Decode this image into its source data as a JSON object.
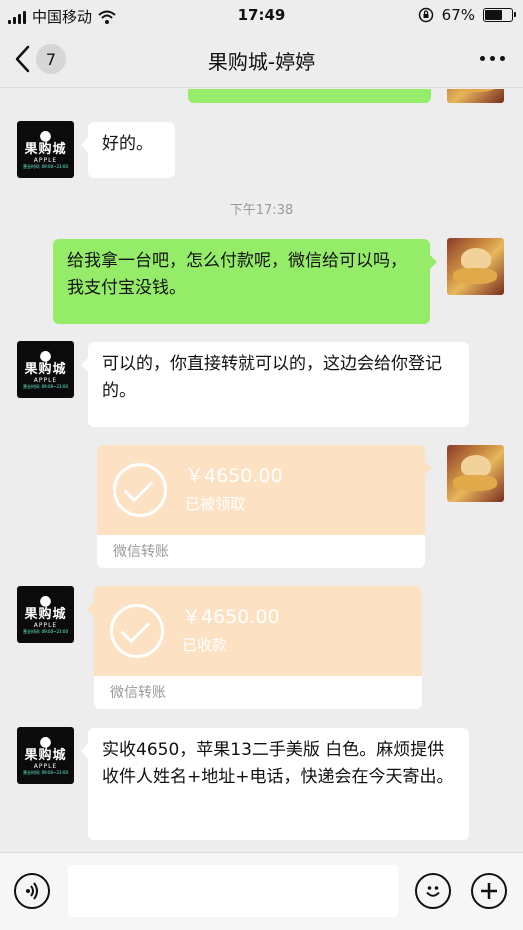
{
  "status_bar": {
    "carrier": "中国移动",
    "time": "17:49",
    "battery": "67%",
    "battery_level": 0.67
  },
  "nav": {
    "unread_count": "7",
    "title": "果购城-婷婷"
  },
  "shop_avatar": {
    "brand": "果购城",
    "sub": "APPLE",
    "hours": "营业时间: 09:00~23:00"
  },
  "messages": {
    "m1": "好的。",
    "timestamp": "下午17:38",
    "m2": "给我拿一台吧，怎么付款呢，微信给可以吗，我支付宝没钱。",
    "m3": "可以的，你直接转就可以的，这边会给你登记的。",
    "transfer1": {
      "amount": "￥4650.00",
      "status": "已被领取",
      "label": "微信转账"
    },
    "transfer2": {
      "amount": "￥4650.00",
      "status": "已收款",
      "label": "微信转账"
    },
    "m4": "实收4650，苹果13二手美版 白色。麻烦提供收件人姓名+地址+电话，快递会在今天寄出。"
  },
  "input": {
    "placeholder": ""
  },
  "colors": {
    "green_bubble": "#95ec69",
    "transfer_bg": "#fde1c3",
    "background": "#ededed"
  }
}
